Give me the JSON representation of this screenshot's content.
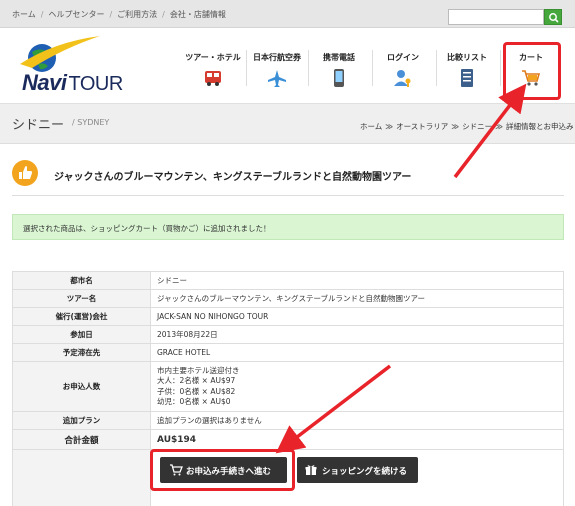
{
  "topbar": {
    "links": [
      "ホーム",
      "ヘルプセンター",
      "ご利用方法",
      "会社・店舗情報"
    ],
    "separator": "/",
    "search_placeholder": ""
  },
  "brand": {
    "logo_prefix": "Navi",
    "logo_suffix": "TOUR"
  },
  "nav": {
    "items": [
      {
        "label": "ツアー・ホテル",
        "icon": "bus-icon"
      },
      {
        "label": "日本行航空券",
        "icon": "airplane-icon"
      },
      {
        "label": "携帯電話",
        "icon": "mobile-phone-icon"
      },
      {
        "label": "ログイン",
        "icon": "user-key-icon"
      },
      {
        "label": "比較リスト",
        "icon": "list-icon"
      },
      {
        "label": "カート",
        "icon": "cart-icon"
      }
    ]
  },
  "page": {
    "title": "シドニー",
    "subtitle": "/ SYDNEY",
    "breadcrumb": [
      "ホーム",
      "オーストラリア",
      "シドニー",
      "詳細情報とお申込み"
    ],
    "breadcrumb_separator": "≫"
  },
  "tour": {
    "title": "ジャックさんのブルーマウンテン、キングステーブルランドと自然動物園ツアー",
    "icon": "thumbs-up-icon"
  },
  "notice": {
    "text": "選択された商品は、ショッピングカート（買物かご）に追加されました！"
  },
  "details": {
    "rows": [
      {
        "label": "都市名",
        "value": "シドニー"
      },
      {
        "label": "ツアー名",
        "value": "ジャックさんのブルーマウンテン、キングステーブルランドと自然動物園ツアー"
      },
      {
        "label": "催行(運営)会社",
        "value": "JACK-SAN NO NIHONGO TOUR"
      },
      {
        "label": "参加日",
        "value": "2013年08月22日"
      },
      {
        "label": "予定滞在先",
        "value": "GRACE HOTEL"
      }
    ],
    "people": {
      "label": "お申込人数",
      "lines": [
        "市内主要ホテル送迎付き",
        "大人：2名様 × AU$97",
        "子供：0名様 × AU$82",
        "幼児：0名様 × AU$0"
      ]
    },
    "extra_plan": {
      "label": "追加プラン",
      "value": "追加プランの選択はありません"
    },
    "total": {
      "label": "合計金額",
      "value": "AU$194"
    }
  },
  "actions": {
    "checkout_label": "お申込み手続きへ進む",
    "continue_label": "ショッピングを続ける"
  },
  "colors": {
    "highlight": "#e8232a",
    "notice_bg": "#d9f5d2",
    "button_bg": "#333333",
    "accent_orange": "#f2a41e",
    "search_green": "#46a83c"
  }
}
